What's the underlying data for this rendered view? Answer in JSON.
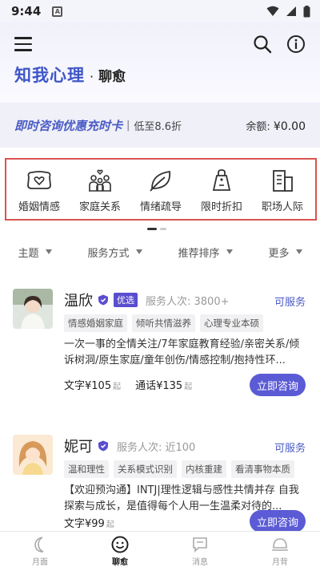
{
  "status_bar": {
    "time": "9:44",
    "badge": "A"
  },
  "header": {
    "brand": "知我心理",
    "separator": "·",
    "subtitle": "聊愈"
  },
  "promo": {
    "title": "即时咨询优惠充时卡",
    "separator": "|",
    "discount": "低至8.6折",
    "balance_label": "余额:",
    "balance_value": "¥0.00"
  },
  "categories": [
    {
      "label": "婚姻情感",
      "icon": "heart-pillow-icon"
    },
    {
      "label": "家庭关系",
      "icon": "family-icon"
    },
    {
      "label": "情绪疏导",
      "icon": "leaf-icon"
    },
    {
      "label": "限时折扣",
      "icon": "price-tag-icon"
    },
    {
      "label": "职场人际",
      "icon": "office-building-icon"
    }
  ],
  "filters": [
    {
      "label": "主题"
    },
    {
      "label": "服务方式"
    },
    {
      "label": "推荐排序"
    },
    {
      "label": "更多"
    }
  ],
  "counselors": [
    {
      "name": "温欣",
      "badge": "优选",
      "serve_count": "服务人次: 3800+",
      "status": "可服务",
      "tags": [
        "情感婚姻家庭",
        "倾听共情滋养",
        "心理专业本硕"
      ],
      "description": "一次一事的全情关注/7年家庭教育经验/亲密关系/倾诉树洞/原生家庭/童年创伤/情感控制/抱持性环...",
      "text_price_label": "文字¥105",
      "text_price_unit": "起",
      "call_price_label": "通话¥135",
      "call_price_unit": "起",
      "button": "立即咨询"
    },
    {
      "name": "妮可",
      "badge": "",
      "serve_count": "服务人次: 近100",
      "status": "可服务",
      "tags": [
        "温和理性",
        "关系模式识别",
        "内核重建",
        "看清事物本质"
      ],
      "description": "【欢迎预沟通】INTJ|理性逻辑与感性共情并存 自我探索与成长，是值得每个人用一生温柔对待的...",
      "text_price_label": "文字¥99",
      "text_price_unit": "起",
      "call_price_label": "",
      "call_price_unit": "",
      "button": "立即咨询"
    }
  ],
  "bottom_nav": [
    {
      "label": "月面",
      "icon": "moon-icon",
      "active": false
    },
    {
      "label": "聊愈",
      "icon": "smile-icon",
      "active": true
    },
    {
      "label": "消息",
      "icon": "message-icon",
      "active": false
    },
    {
      "label": "月背",
      "icon": "moon-back-icon",
      "active": false
    }
  ],
  "colors": {
    "brand": "#3f56c8",
    "accent": "#5b5bd6",
    "highlight_border": "#d9534f"
  }
}
